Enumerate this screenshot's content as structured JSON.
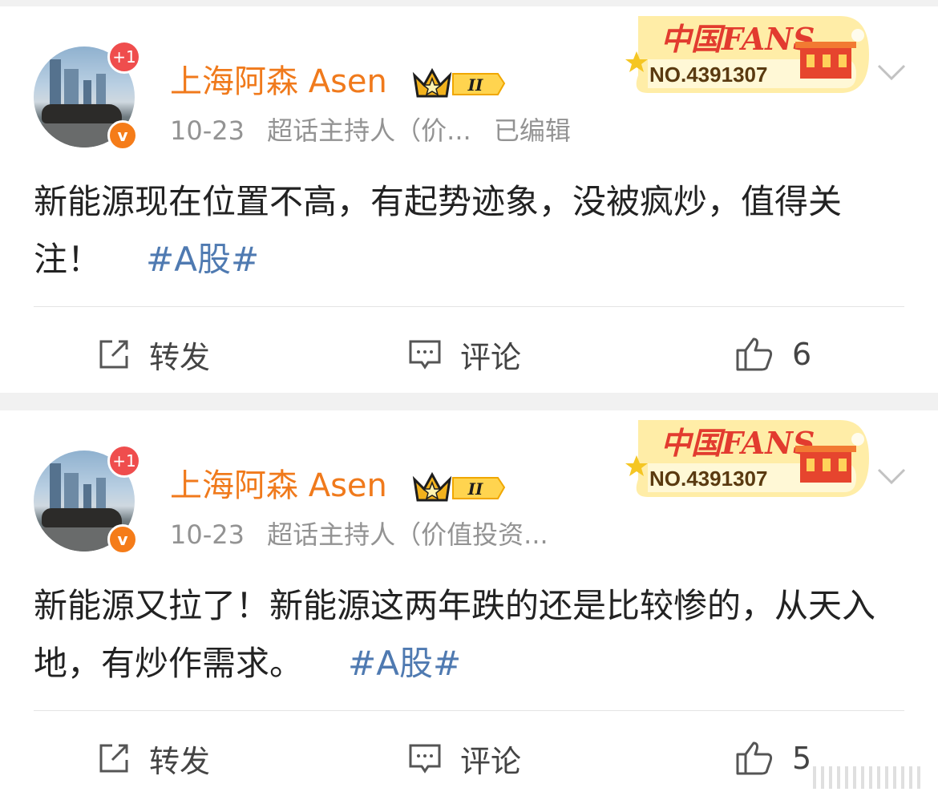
{
  "posts": [
    {
      "avatar_badge": "+1",
      "verified_badge": "v",
      "author": "上海阿森 Asen",
      "level_badge": "II",
      "date": "10-23",
      "source": "超话主持人（价...",
      "edited": "已编辑",
      "fans_label": "中国FANS",
      "fans_number": "NO.4391307",
      "body": "新能源现在位置不高，有起势迹象，没被疯炒，值得关注！",
      "hashtag": "#A股#",
      "repost_label": "转发",
      "comment_label": "评论",
      "like_count": "6"
    },
    {
      "avatar_badge": "+1",
      "verified_badge": "v",
      "author": "上海阿森 Asen",
      "level_badge": "II",
      "date": "10-23",
      "source": "超话主持人（价值投资...",
      "edited": "",
      "fans_label": "中国FANS",
      "fans_number": "NO.4391307",
      "body": "新能源又拉了！新能源这两年跌的还是比较惨的，从天入地，有炒作需求。",
      "hashtag": "#A股#",
      "repost_label": "转发",
      "comment_label": "评论",
      "like_count": "5"
    }
  ],
  "colors": {
    "author": "#f07a1c",
    "hashtag": "#4f7ab1",
    "meta": "#939393",
    "badge_red": "#ef4d4d",
    "badge_orange": "#f57c19"
  },
  "icons": [
    "repost-icon",
    "comment-icon",
    "like-icon",
    "chevron-down-icon",
    "crown-icon"
  ]
}
